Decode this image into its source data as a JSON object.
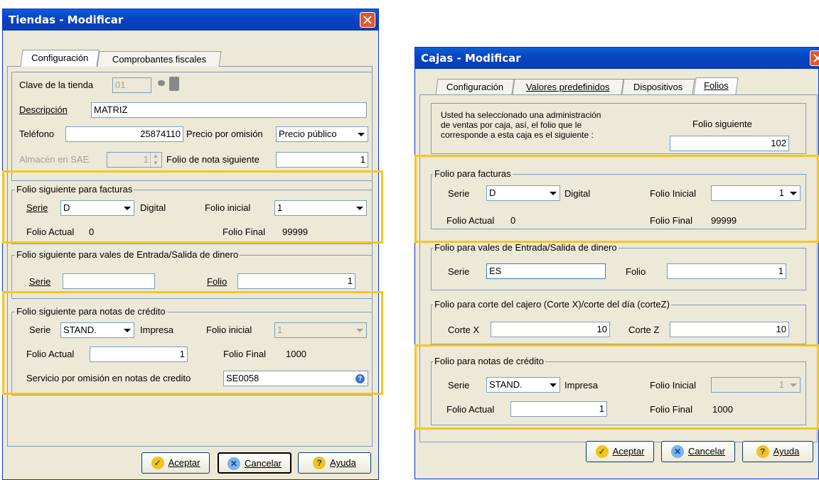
{
  "tiendas": {
    "title": "Tiendas - Modificar",
    "tabs": [
      "Configuración",
      "Comprobantes fiscales"
    ],
    "clave_label": "Clave de la tienda",
    "clave_value": "01",
    "descripcion_label": "Descripción",
    "descripcion_value": "MATRIZ",
    "telefono_label": "Teléfono",
    "telefono_value": "25874110",
    "precio_label": "Precio por omisión",
    "precio_value": "Precio público",
    "almacen_label": "Almacén en SAE",
    "almacen_value": "1",
    "folio_nota_label": "Folio de nota siguiente",
    "folio_nota_value": "1",
    "facturas": {
      "legend": "Folio siguiente para facturas",
      "serie_label": "Serie",
      "serie_value": "D",
      "serie_type": "Digital",
      "folio_inicial_label": "Folio inicial",
      "folio_inicial_value": "1",
      "folio_actual_label": "Folio Actual",
      "folio_actual_value": "0",
      "folio_final_label": "Folio Final",
      "folio_final_value": "99999"
    },
    "vales": {
      "legend": "Folio siguiente para vales de Entrada/Salida de dinero",
      "serie_label": "Serie",
      "serie_value": "",
      "folio_label": "Folio",
      "folio_value": "1"
    },
    "notas": {
      "legend": "Folio siguiente para notas de crédito",
      "serie_label": "Serie",
      "serie_value": "STAND.",
      "serie_type": "Impresa",
      "folio_inicial_label": "Folio inicial",
      "folio_inicial_value": "1",
      "folio_actual_label": "Folio Actual",
      "folio_actual_value": "1",
      "folio_final_label": "Folio Final",
      "folio_final_value": "1000",
      "servicio_label": "Servicio por omisión en notas de credito",
      "servicio_value": "SE0058"
    },
    "buttons": {
      "aceptar": "Aceptar",
      "cancelar": "Cancelar",
      "ayuda": "Ayuda"
    }
  },
  "cajas": {
    "title": "Cajas - Modificar",
    "tabs": [
      "Configuración",
      "Valores predefinidos",
      "Dispositivos",
      "Folios"
    ],
    "info_text_1": "Usted ha seleccionado una administración",
    "info_text_2": "de ventas por caja, así, el folio que le",
    "info_text_3": "corresponde a esta caja es el siguiente :",
    "folio_siguiente_label": "Folio siguiente",
    "folio_siguiente_value": "102",
    "facturas": {
      "legend": "Folio para facturas",
      "serie_label": "Serie",
      "serie_value": "D",
      "serie_type": "Digital",
      "folio_inicial_label": "Folio Inicial",
      "folio_inicial_value": "1",
      "folio_actual_label": "Folio Actual",
      "folio_actual_value": "0",
      "folio_final_label": "Folio Final",
      "folio_final_value": "99999"
    },
    "vales": {
      "legend": "Folio para vales de Entrada/Salida de dinero",
      "serie_label": "Serie",
      "serie_value": "ES",
      "folio_label": "Folio",
      "folio_value": "1"
    },
    "corte": {
      "legend": "Folio para  corte del cajero (Corte X)/corte del día (corteZ)",
      "cortex_label": "Corte X",
      "cortex_value": "10",
      "cortez_label": "Corte Z",
      "cortez_value": "10"
    },
    "notas": {
      "legend": "Folio para notas de crédito",
      "serie_label": "Serie",
      "serie_value": "STAND.",
      "serie_type": "Impresa",
      "folio_inicial_label": "Folio Inicial",
      "folio_inicial_value": "1",
      "folio_actual_label": "Folio Actual",
      "folio_actual_value": "1",
      "folio_final_label": "Folio Final",
      "folio_final_value": "1000"
    },
    "buttons": {
      "aceptar": "Aceptar",
      "cancelar": "Cancelar",
      "ayuda": "Ayuda"
    }
  },
  "colors": {
    "highlight": "#f7c520",
    "titlebar": "#0a5fd8",
    "dialog_bg": "#ece9d8"
  }
}
